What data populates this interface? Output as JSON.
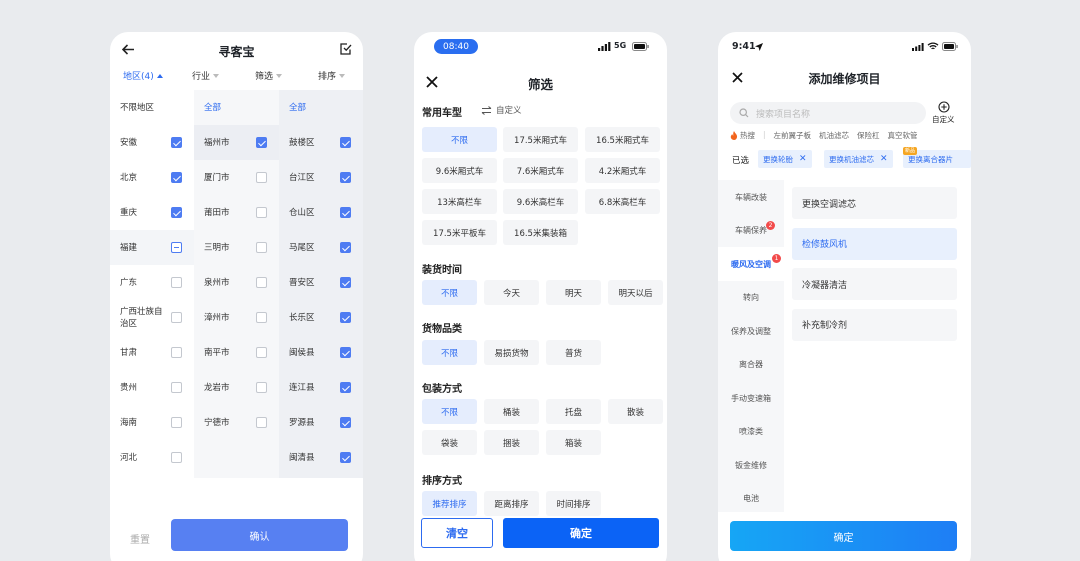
{
  "p1": {
    "title": "寻客宝",
    "tabs": [
      "地区(4)",
      "行业",
      "筛选",
      "排序"
    ],
    "col1": [
      {
        "label": "不限地区",
        "state": "none"
      },
      {
        "label": "安徽",
        "state": "on"
      },
      {
        "label": "北京",
        "state": "on"
      },
      {
        "label": "重庆",
        "state": "on"
      },
      {
        "label": "福建",
        "state": "half"
      },
      {
        "label": "广东",
        "state": "off"
      },
      {
        "label": "广西壮族自治区",
        "state": "off"
      },
      {
        "label": "甘肃",
        "state": "off"
      },
      {
        "label": "贵州",
        "state": "off"
      },
      {
        "label": "海南",
        "state": "off"
      },
      {
        "label": "河北",
        "state": "off"
      }
    ],
    "col2": [
      {
        "label": "全部",
        "state": "none"
      },
      {
        "label": "福州市",
        "state": "on"
      },
      {
        "label": "厦门市",
        "state": "off"
      },
      {
        "label": "莆田市",
        "state": "off"
      },
      {
        "label": "三明市",
        "state": "off"
      },
      {
        "label": "泉州市",
        "state": "off"
      },
      {
        "label": "漳州市",
        "state": "off"
      },
      {
        "label": "南平市",
        "state": "off"
      },
      {
        "label": "龙岩市",
        "state": "off"
      },
      {
        "label": "宁德市",
        "state": "off"
      }
    ],
    "col3": [
      {
        "label": "全部",
        "state": "none"
      },
      {
        "label": "鼓楼区",
        "state": "on"
      },
      {
        "label": "台江区",
        "state": "on"
      },
      {
        "label": "仓山区",
        "state": "on"
      },
      {
        "label": "马尾区",
        "state": "on"
      },
      {
        "label": "晋安区",
        "state": "on"
      },
      {
        "label": "长乐区",
        "state": "on"
      },
      {
        "label": "闽侯县",
        "state": "on"
      },
      {
        "label": "连江县",
        "state": "on"
      },
      {
        "label": "罗源县",
        "state": "on"
      },
      {
        "label": "闽清县",
        "state": "on"
      }
    ],
    "reset": "重置",
    "confirm": "确认"
  },
  "p2": {
    "time": "08:40",
    "network": "5G",
    "title": "筛选",
    "s1": "常用车型",
    "custom": "自定义",
    "vehicles": [
      "不限",
      "17.5米厢式车",
      "16.5米厢式车",
      "9.6米厢式车",
      "7.6米厢式车",
      "4.2米厢式车",
      "13米高栏车",
      "9.6米高栏车",
      "6.8米高栏车",
      "17.5米平板车",
      "16.5米集装箱"
    ],
    "s2": "装货时间",
    "times": [
      "不限",
      "今天",
      "明天",
      "明天以后"
    ],
    "s3": "货物品类",
    "goods": [
      "不限",
      "易损货物",
      "普货"
    ],
    "s4": "包装方式",
    "packs": [
      "不限",
      "桶装",
      "托盘",
      "散装",
      "袋装",
      "捆装",
      "箱装"
    ],
    "s5": "排序方式",
    "sorts": [
      "推荐排序",
      "距离排序",
      "时间排序"
    ],
    "clear": "清空",
    "ok": "确定"
  },
  "p3": {
    "time": "9:41",
    "title": "添加维修项目",
    "placeholder": "搜索项目名称",
    "custom": "自定义",
    "hot": [
      "热搜",
      "左前翼子板",
      "机油滤芯",
      "保险杠",
      "真空软管"
    ],
    "selected_label": "已选",
    "tags": [
      "更换轮胎",
      "更换机油滤芯",
      "更换离合器片"
    ],
    "tag_mini": "新品",
    "side": [
      "车辆改装",
      "车辆保养",
      "暖风及空调",
      "转向",
      "保养及调整",
      "离合器",
      "手动变速箱",
      "喷漆类",
      "钣金维修",
      "电池"
    ],
    "badges": [
      "2",
      "1"
    ],
    "items": [
      "更换空调滤芯",
      "检修鼓风机",
      "冷凝器清洁",
      "补充制冷剂"
    ],
    "ok": "确定"
  }
}
